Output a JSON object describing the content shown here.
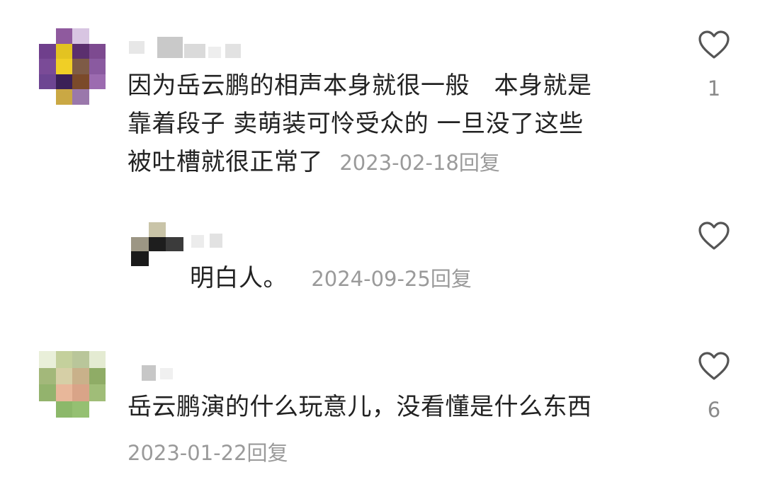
{
  "comments": [
    {
      "text_lines": [
        "因为岳云鹏的相声本身就很一般　本身就是",
        "靠着段子 卖萌装可怜受众的 一旦没了这些",
        "被吐槽就很正常了"
      ],
      "date": "2023-02-18",
      "reply_label": "回复",
      "like_count": "1",
      "replies": [
        {
          "text": "明白人。",
          "date": "2024-09-25",
          "reply_label": "回复"
        }
      ]
    },
    {
      "text_lines": [
        "岳云鹏演的什么玩意儿，没看懂是什么东西"
      ],
      "date": "2023-01-22",
      "reply_label": "回复",
      "like_count": "6"
    }
  ],
  "colors": {
    "text": "#222222",
    "meta": "#9a9a9a",
    "icon": "#555555"
  },
  "icons": [
    "heart-outline-icon"
  ]
}
